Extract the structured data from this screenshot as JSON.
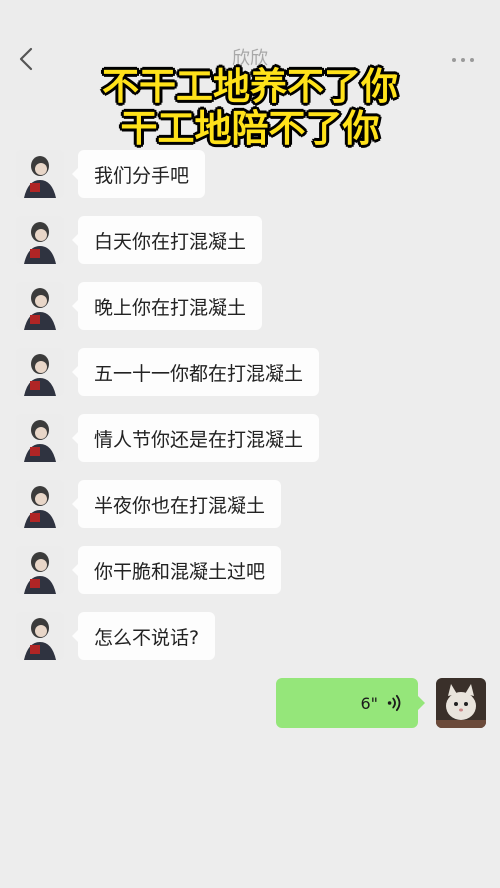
{
  "header": {
    "contact_name": "欣欣",
    "back_icon": "chevron-left-icon",
    "more_icon": "more-dots-icon"
  },
  "caption": {
    "line1": "不干工地养不了你",
    "line2": "干工地陪不了你",
    "color": "#ffe21a"
  },
  "messages": [
    {
      "text": "我们分手吧"
    },
    {
      "text": "白天你在打混凝土"
    },
    {
      "text": "晚上你在打混凝土"
    },
    {
      "text": "五一十一你都在打混凝土"
    },
    {
      "text": "情人节你还是在打混凝土"
    },
    {
      "text": "半夜你也在打混凝土"
    },
    {
      "text": "你干脆和混凝土过吧"
    },
    {
      "text": "怎么不说话?"
    }
  ],
  "outgoing": {
    "voice_duration": "6\"",
    "voice_icon": "voice-wave-icon"
  },
  "colors": {
    "background": "#ededed",
    "bubble_in": "#fdfdfd",
    "bubble_out": "#95e67a"
  }
}
